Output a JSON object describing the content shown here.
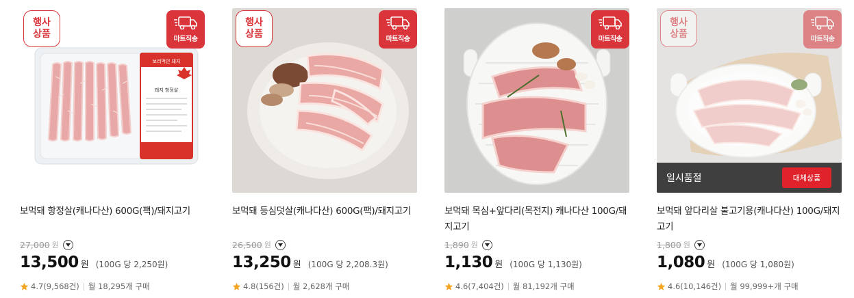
{
  "products": [
    {
      "event_label": "행사\n상품",
      "ship_label": "마트직송",
      "title": "보먹돼 항정살(캐나다산) 600G(팩)/돼지고기",
      "original_price": "27,000",
      "original_unit": "원",
      "price": "13,500",
      "price_unit": "원",
      "unit_price": "(100G 당 2,250원)",
      "rating": "4.7(9,568건)",
      "sales": "월 18,295개 구매",
      "sold_out": false,
      "package_label": "돼지 항정살",
      "package_brand": "보리먹인 돼지"
    },
    {
      "event_label": "행사\n상품",
      "ship_label": "마트직송",
      "title": "보먹돼 등심덧살(캐나다산) 600G(팩)/돼지고기",
      "original_price": "26,500",
      "original_unit": "원",
      "price": "13,250",
      "price_unit": "원",
      "unit_price": "(100G 당 2,208.3원)",
      "rating": "4.8(156건)",
      "sales": "월 2,628개 구매",
      "sold_out": false
    },
    {
      "event_label": "",
      "ship_label": "마트직송",
      "title": "보먹돼 목심+앞다리(목전지) 캐나다산 100G/돼지고기",
      "original_price": "1,890",
      "original_unit": "원",
      "price": "1,130",
      "price_unit": "원",
      "unit_price": "(100G 당 1,130원)",
      "rating": "4.6(7,404건)",
      "sales": "월 81,192개 구매",
      "sold_out": false
    },
    {
      "event_label": "행사\n상품",
      "ship_label": "마트직송",
      "title": "보먹돼 앞다리살 불고기용(캐나다산) 100G/돼지고기",
      "original_price": "1,800",
      "original_unit": "원",
      "price": "1,080",
      "price_unit": "원",
      "unit_price": "(100G 당 1,080원)",
      "rating": "4.6(10,146건)",
      "sales": "월 99,999+개 구매",
      "sold_out": true,
      "soldout_label": "일시품절",
      "replace_label": "대체상품"
    }
  ],
  "colors": {
    "accent": "#d9353a",
    "star": "#f5a623"
  }
}
